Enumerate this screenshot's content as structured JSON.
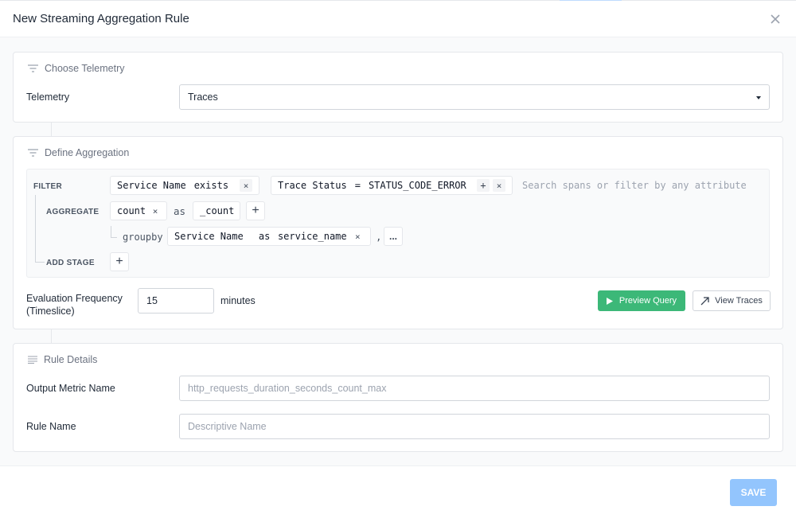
{
  "modal": {
    "title": "New Streaming Aggregation Rule"
  },
  "telemetry_section": {
    "title": "Choose Telemetry",
    "field_label": "Telemetry",
    "selected": "Traces"
  },
  "aggregation_section": {
    "title": "Define Aggregation",
    "filter": {
      "keyword": "FILTER",
      "chips": [
        {
          "field": "Service Name",
          "op": "exists",
          "value": ""
        },
        {
          "field": "Trace Status",
          "op": "=",
          "value": "STATUS_CODE_ERROR"
        }
      ],
      "search_placeholder": "Search spans or filter by any attribute"
    },
    "aggregate": {
      "keyword": "AGGREGATE",
      "function": "count",
      "as_label": "as",
      "alias": "_count"
    },
    "groupby": {
      "keyword": "groupby",
      "field": "Service Name",
      "as_label": "as",
      "alias": "service_name",
      "separator": ",",
      "more_label": "..."
    },
    "add_stage": {
      "keyword": "ADD STAGE"
    },
    "evaluation": {
      "label_line1": "Evaluation Frequency",
      "label_line2": "(Timeslice)",
      "value": "15",
      "unit": "minutes"
    },
    "buttons": {
      "preview": "Preview Query",
      "view_traces": "View Traces"
    }
  },
  "rule_section": {
    "title": "Rule Details",
    "output_metric_label": "Output Metric Name",
    "output_metric_placeholder": "http_requests_duration_seconds_count_max",
    "rule_name_label": "Rule Name",
    "rule_name_placeholder": "Descriptive Name"
  },
  "footer": {
    "save_label": "SAVE"
  },
  "colors": {
    "preview_button": "#3cb878",
    "save_button": "#93c5fd"
  }
}
